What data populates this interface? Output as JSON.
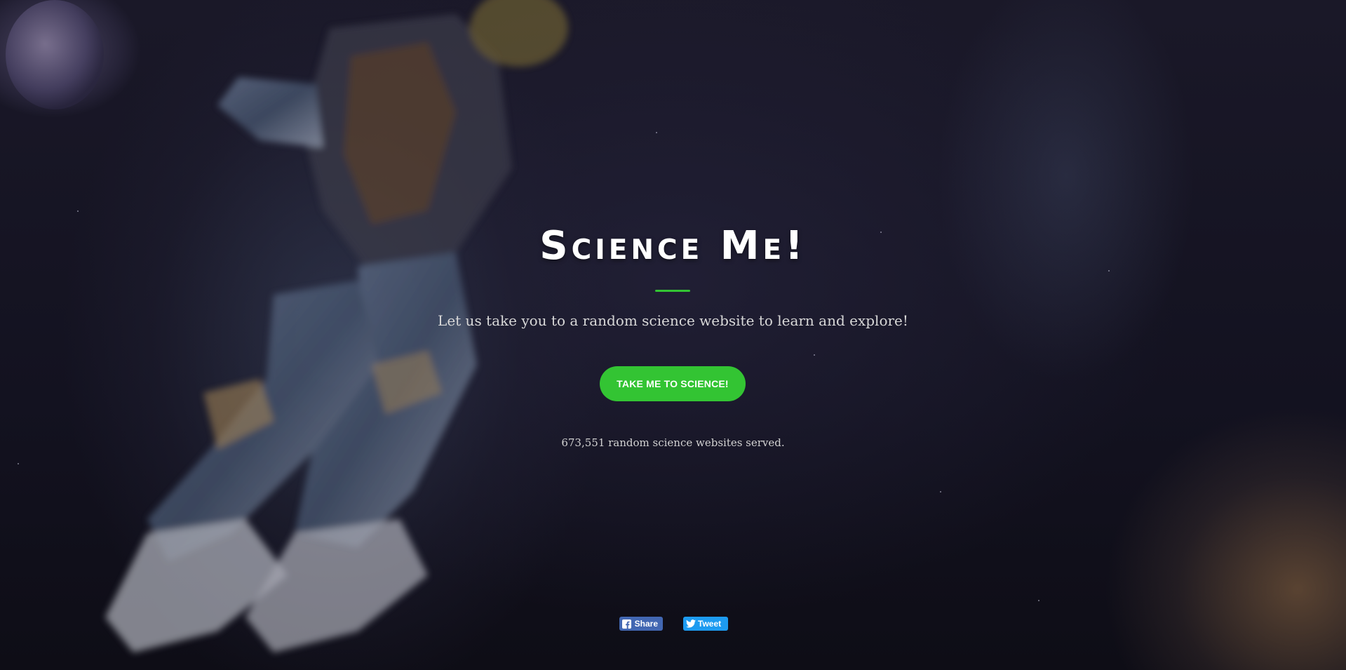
{
  "page": {
    "title": "Science Me!",
    "subtitle": "Let us take you to a random science website to learn and explore!",
    "cta_label": "TAKE ME TO SCIENCE!",
    "counter_text": "673,551 random science websites served."
  },
  "social": {
    "facebook_label": "Share",
    "twitter_label": "Tweet"
  },
  "colors": {
    "accent": "#33c433",
    "facebook": "#4267b2",
    "twitter": "#1d9bf0",
    "background": "#12111c"
  },
  "icons": [
    "facebook-icon",
    "twitter-icon"
  ]
}
